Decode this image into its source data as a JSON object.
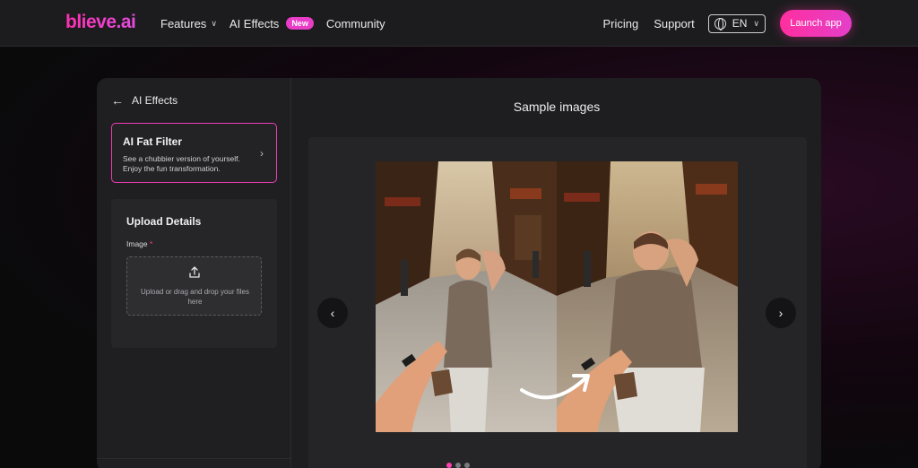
{
  "nav": {
    "logo": "blieve.ai",
    "features": "Features",
    "ai_effects": "AI Effects",
    "new_badge": "New",
    "community": "Community",
    "pricing": "Pricing",
    "support": "Support",
    "language": "EN",
    "launch": "Launch app"
  },
  "sidebar": {
    "back_label": "AI Effects",
    "filter": {
      "title": "AI Fat Filter",
      "description": "See a chubbier version of yourself. Enjoy the fun transformation."
    },
    "upload": {
      "title": "Upload Details",
      "image_label": "Image",
      "required_mark": "*",
      "dropzone_text": "Upload or drag and drop your files here"
    }
  },
  "main": {
    "title": "Sample images",
    "carousel": {
      "slide_count": 3,
      "active_index": 0
    }
  },
  "colors": {
    "accent": "#ff2fb1",
    "background": "#0a0a0b",
    "card": "#1e1e20"
  }
}
